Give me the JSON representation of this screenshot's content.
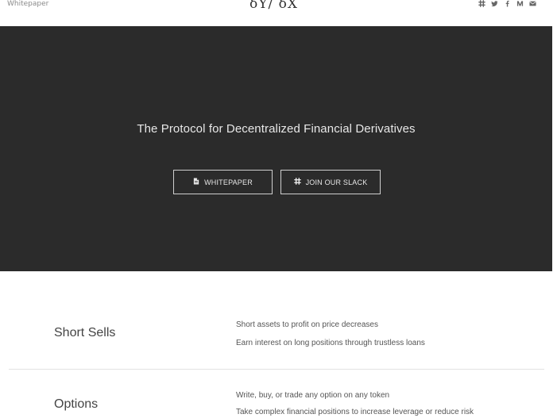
{
  "header": {
    "nav_link": "Whitepaper",
    "logo": "δY/ δX",
    "social_icons": [
      "slack-icon",
      "twitter-icon",
      "facebook-icon",
      "medium-icon",
      "email-icon"
    ]
  },
  "hero": {
    "title": "The Protocol for Decentralized Financial Derivatives",
    "buttons": [
      {
        "label": "WHITEPAPER",
        "icon": "document-icon"
      },
      {
        "label": "JOIN OUR SLACK",
        "icon": "slack-icon"
      }
    ],
    "background_color": "#2b2b2b"
  },
  "features": [
    {
      "title": "Short Sells",
      "lines": [
        "Short assets to profit on price decreases",
        "Earn interest on long positions through trustless loans"
      ]
    },
    {
      "title": "Options",
      "lines": [
        "Write, buy, or trade any option on any token",
        "Take complex financial positions to increase leverage or reduce risk"
      ]
    }
  ]
}
